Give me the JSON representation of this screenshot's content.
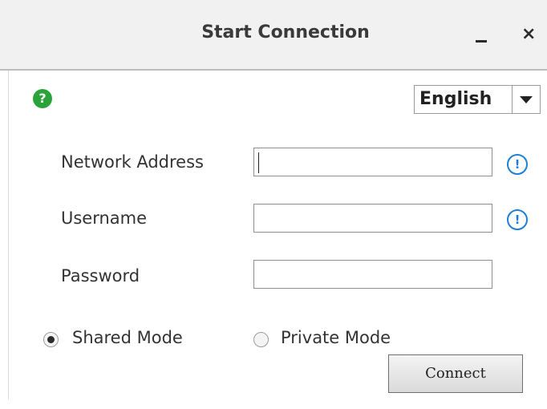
{
  "window": {
    "title": "Start Connection",
    "minimize_label": "_",
    "close_label": "×"
  },
  "help": {
    "icon": "question-circle-icon",
    "glyph": "?",
    "color": "#2aa33a"
  },
  "language": {
    "selected": "English"
  },
  "form": {
    "network_address": {
      "label": "Network Address",
      "value": "",
      "warning_glyph": "!"
    },
    "username": {
      "label": "Username",
      "value": "",
      "warning_glyph": "!"
    },
    "password": {
      "label": "Password",
      "value": ""
    }
  },
  "mode": {
    "shared_label": "Shared Mode",
    "private_label": "Private Mode",
    "selected": "shared"
  },
  "actions": {
    "connect_label": "Connect"
  },
  "colors": {
    "info_icon": "#1e7fd6",
    "help_icon": "#2aa33a"
  }
}
